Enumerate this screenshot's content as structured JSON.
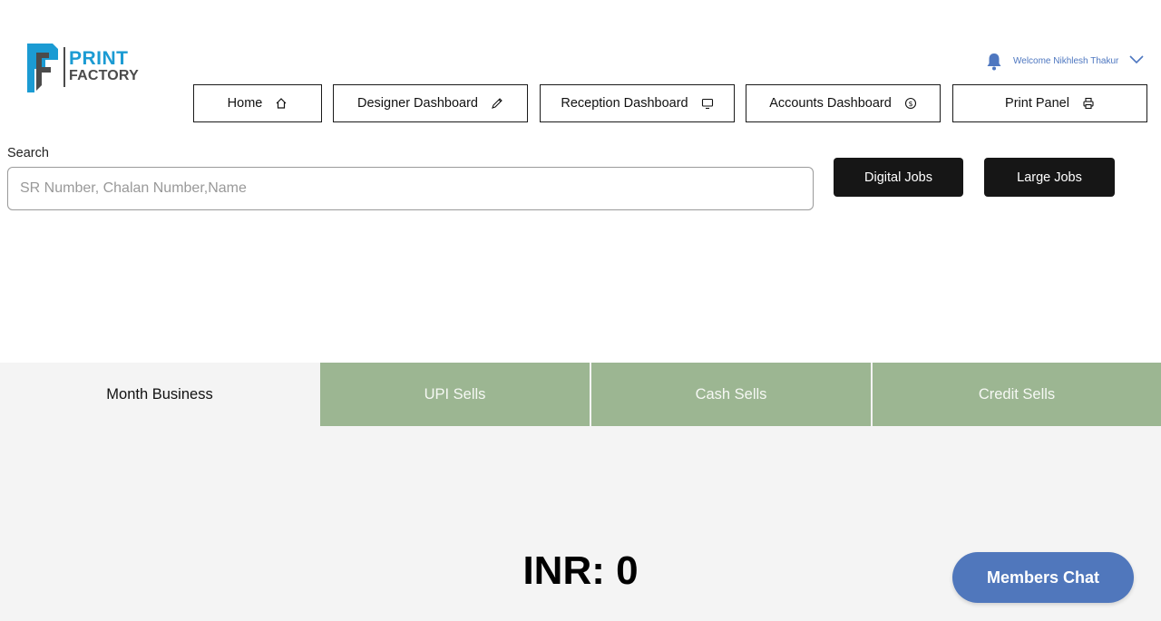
{
  "brand": {
    "line1": "PRINT",
    "line2": "FACTORY",
    "primary_color": "#1b9bd3",
    "secondary_color": "#4b4b4b"
  },
  "header": {
    "welcome": "Welcome Nikhlesh Thakur",
    "notification_icon": "bell-icon",
    "menu_icon": "chevron-down-icon",
    "accent": "#4e77c0"
  },
  "nav": [
    {
      "label": "Home",
      "icon": "home-icon"
    },
    {
      "label": "Designer Dashboard",
      "icon": "pencil-icon"
    },
    {
      "label": "Reception Dashboard",
      "icon": "monitor-icon"
    },
    {
      "label": "Accounts Dashboard",
      "icon": "dollar-icon"
    },
    {
      "label": "Print Panel",
      "icon": "printer-icon"
    }
  ],
  "search": {
    "label": "Search",
    "placeholder": "SR Number, Chalan Number,Name",
    "value": ""
  },
  "jobs": {
    "digital": "Digital Jobs",
    "large": "Large Jobs"
  },
  "tabs": [
    {
      "label": "Month Business",
      "active": true
    },
    {
      "label": "UPI Sells",
      "active": false
    },
    {
      "label": "Cash Sells",
      "active": false
    },
    {
      "label": "Credit Sells",
      "active": false
    }
  ],
  "tab_color": "#9cb692",
  "amount": "INR: 0",
  "chat": {
    "label": "Members Chat",
    "color": "#5077bc"
  }
}
